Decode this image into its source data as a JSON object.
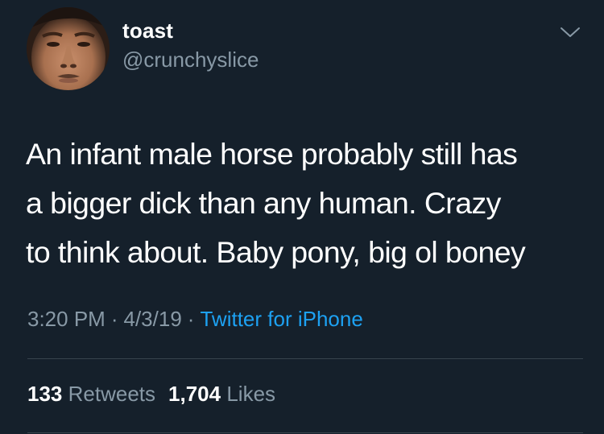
{
  "user": {
    "display_name": "toast",
    "handle": "@crunchyslice"
  },
  "tweet": {
    "text_lines": [
      "An infant male horse probably still has",
      "a bigger dick than any human. Crazy",
      "to think about. Baby pony, big ol boney"
    ],
    "time": "3:20 PM",
    "date": "4/3/19",
    "separator": "·",
    "source": "Twitter for iPhone"
  },
  "stats": {
    "retweets_count": "133",
    "retweets_label": "Retweets",
    "likes_count": "1,704",
    "likes_label": "Likes"
  },
  "icons": {
    "menu": "chevron-down-icon"
  },
  "colors": {
    "background": "#15202b",
    "text": "#ffffff",
    "secondary_text": "#8899a6",
    "link": "#1da1f2",
    "divider": "#38444d"
  }
}
